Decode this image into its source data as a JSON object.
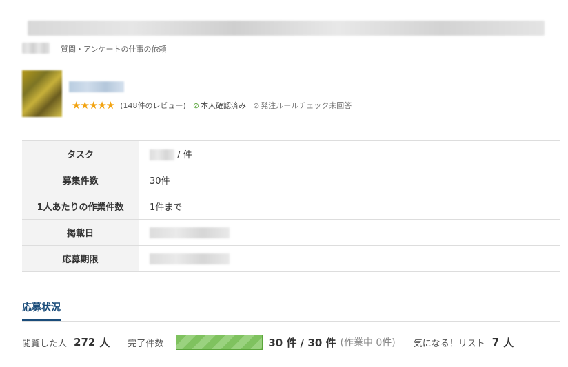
{
  "header": {
    "category": "質問・アンケートの仕事の依頼"
  },
  "client": {
    "rating_stars": "★★★★★",
    "reviews": "(148件のレビュー)",
    "verified": "本人確認済み",
    "rule_check": "発注ルールチェック未回答",
    "icons": {
      "verified": "check-circle-icon",
      "rule_check": "check-circle-icon"
    }
  },
  "details": {
    "rows": [
      {
        "label": "タスク",
        "value": "/ 件"
      },
      {
        "label": "募集件数",
        "value": "30件"
      },
      {
        "label": "1人あたりの作業件数",
        "value": "1件まで"
      },
      {
        "label": "掲載日",
        "value": ""
      },
      {
        "label": "応募期限",
        "value": ""
      }
    ]
  },
  "status": {
    "heading": "応募状況",
    "viewed_label": "閲覧した人",
    "viewed_count": "272",
    "viewed_unit": "人",
    "completed_label": "完了件数",
    "progress": 1.0,
    "completed_text": "30 件 / 30 件",
    "working_text": "(作業中 0件)",
    "watchlist_label": "気になる！リスト",
    "watchlist_count": "7",
    "watchlist_unit": "人"
  },
  "colors": {
    "accent": "#1a4c7a",
    "stars": "#f2a311",
    "progress": "#7fc25f"
  }
}
